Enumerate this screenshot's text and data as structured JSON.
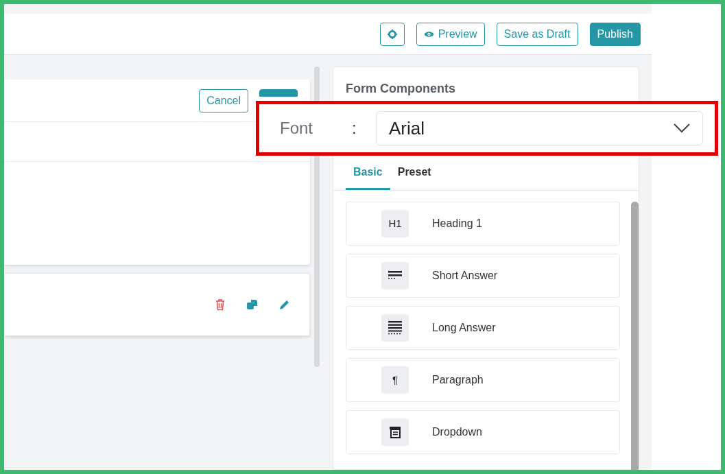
{
  "toolbar": {
    "buttons": [
      {
        "kind": "icon_only"
      },
      {
        "kind": "outline_icon",
        "label": "Preview"
      },
      {
        "kind": "outline",
        "label": "Save as Draft"
      },
      {
        "kind": "solid",
        "label": "Publish"
      }
    ]
  },
  "editor_card": {
    "buttons": [
      {
        "kind": "outline",
        "label": "Cancel"
      },
      {
        "kind": "solid"
      }
    ]
  },
  "form_components": {
    "title": "Form Components",
    "tabs": [
      {
        "label": "Basic",
        "selected": true
      },
      {
        "label": "Preset",
        "selected": false
      }
    ],
    "items": [
      {
        "kind": "text_icon",
        "icon_text": "H1",
        "label": "Heading 1"
      },
      {
        "kind": "short",
        "label": "Short Answer"
      },
      {
        "kind": "long",
        "label": "Long Answer"
      },
      {
        "kind": "text_icon",
        "icon_text": "¶",
        "label": "Paragraph"
      },
      {
        "kind": "dropdown",
        "label": "Dropdown"
      }
    ]
  },
  "callout": {
    "label": "Font",
    "separator": ":",
    "value": "Arial"
  }
}
